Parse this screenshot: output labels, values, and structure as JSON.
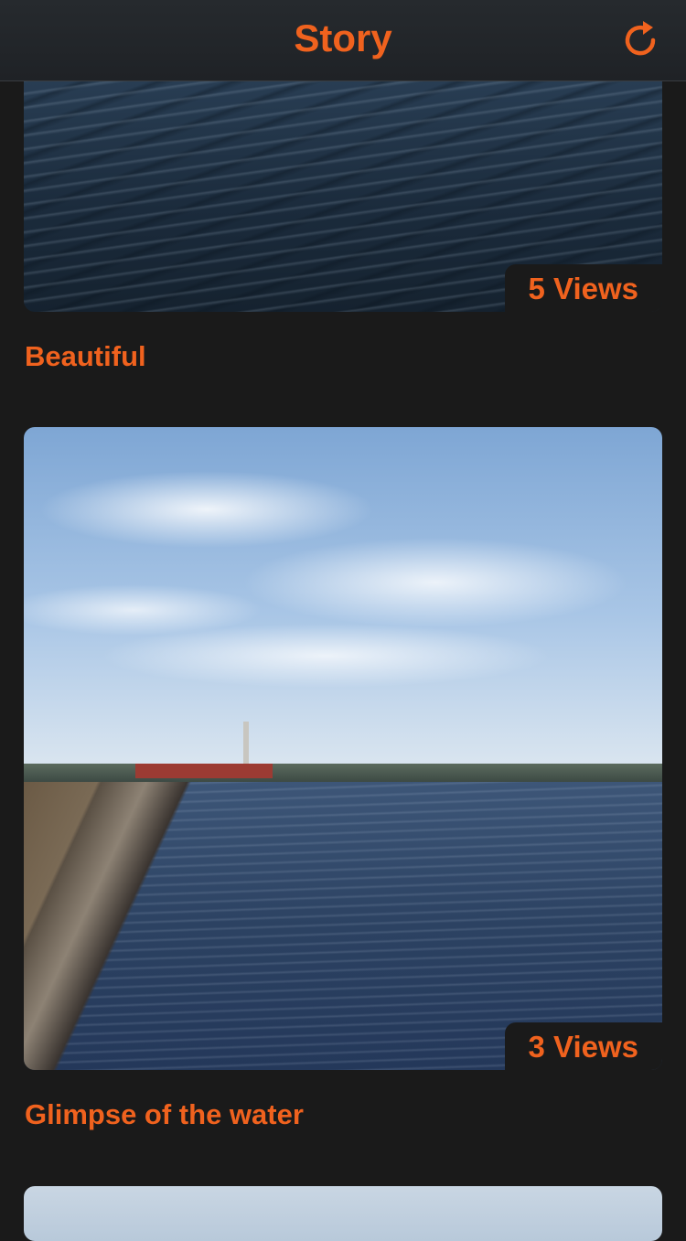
{
  "colors": {
    "accent": "#f0621e",
    "background": "#1a1a1a"
  },
  "navbar": {
    "title": "Story",
    "refresh_icon": "refresh-icon"
  },
  "feed": [
    {
      "views": "5 Views",
      "caption": "Beautiful",
      "image": "dark rippling water"
    },
    {
      "views": "3 Views",
      "caption": "Glimpse of the water",
      "image": "lake with pier and cloudy sky"
    },
    {
      "image": "sky"
    }
  ]
}
